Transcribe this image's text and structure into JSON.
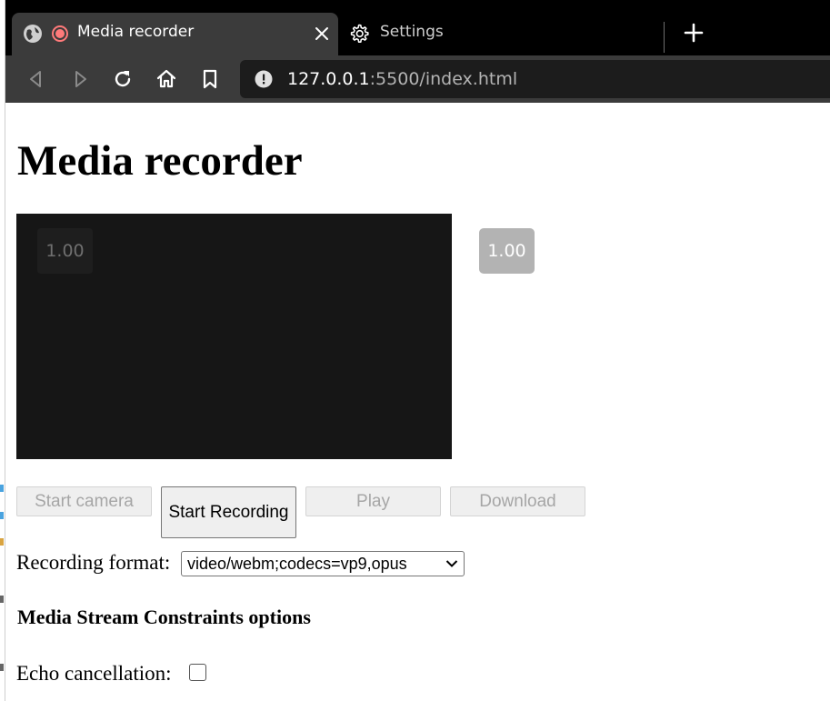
{
  "browser": {
    "active_tab": {
      "title": "Media recorder"
    },
    "inactive_tab": {
      "title": "Settings"
    },
    "url": {
      "host": "127.0.0.1",
      "rest": ":5500/index.html"
    }
  },
  "page": {
    "title": "Media recorder",
    "playback_rate_overlay": "1.00",
    "playback_rate_badge": "1.00",
    "buttons": {
      "start_camera": "Start camera",
      "start_recording": "Start Recording",
      "play": "Play",
      "download": "Download"
    },
    "recording_format_label": "Recording format:",
    "recording_format_value": "video/webm;codecs=vp9,opus",
    "constraints_heading": "Media Stream Constraints options",
    "echo_cancellation_label": "Echo cancellation:",
    "echo_cancellation_checked": false
  }
}
